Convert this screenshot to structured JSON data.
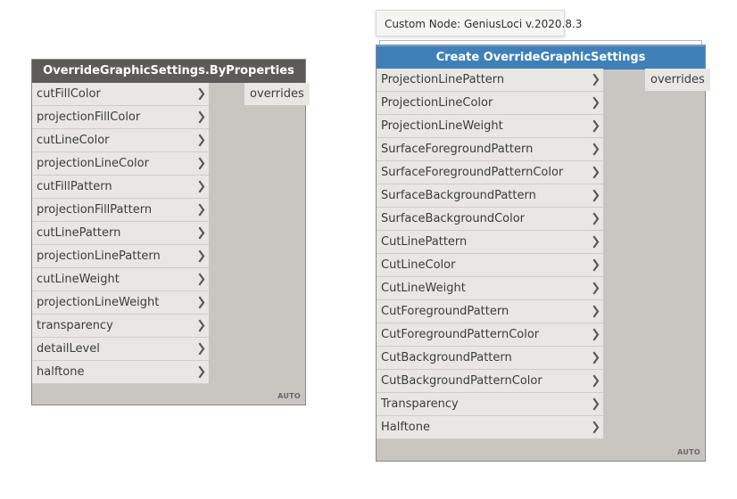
{
  "node_a": {
    "title": "OverrideGraphicSettings.ByProperties",
    "inputs": [
      "cutFillColor",
      "projectionFillColor",
      "cutLineColor",
      "projectionLineColor",
      "cutFillPattern",
      "projectionFillPattern",
      "cutLinePattern",
      "projectionLinePattern",
      "cutLineWeight",
      "projectionLineWeight",
      "transparency",
      "detailLevel",
      "halftone"
    ],
    "output": "overrides",
    "lacing": "AUTO"
  },
  "node_b": {
    "tooltip": "Custom Node: GeniusLoci v.2020.8.3",
    "title": "Create OverrideGraphicSettings",
    "inputs": [
      "ProjectionLinePattern",
      "ProjectionLineColor",
      "ProjectionLineWeight",
      "SurfaceForegroundPattern",
      "SurfaceForegroundPatternColor",
      "SurfaceBackgroundPattern",
      "SurfaceBackgroundColor",
      "CutLinePattern",
      "CutLineColor",
      "CutLineWeight",
      "CutForegroundPattern",
      "CutForegroundPatternColor",
      "CutBackgroundPattern",
      "CutBackgroundPatternColor",
      "Transparency",
      "Halftone"
    ],
    "output": "overrides",
    "lacing": "AUTO"
  },
  "icons": {
    "port_arrow": "chevron-right-icon"
  },
  "colors": {
    "header_builtin": "#5d5b59",
    "header_custom": "#3f80b9",
    "node_body": "#c9c6c2",
    "port_bg": "#e8e7e4"
  }
}
